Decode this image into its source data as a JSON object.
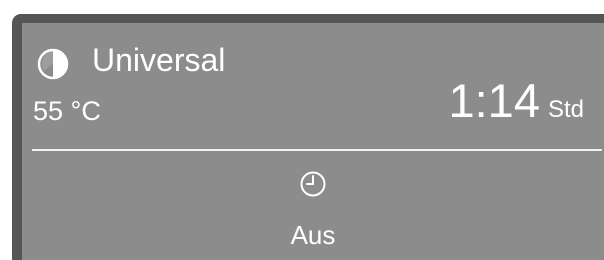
{
  "program": {
    "icon": "half-filled-circle-icon",
    "name": "Universal",
    "temperature": "55 °C"
  },
  "duration": {
    "value": "1:14",
    "unit": "Std"
  },
  "timer": {
    "icon": "clock-icon",
    "label": "Aus"
  },
  "colors": {
    "frame": "#555555",
    "screen": "#8c8c8c",
    "text": "#ffffff",
    "divider": "#f2f2f2"
  }
}
